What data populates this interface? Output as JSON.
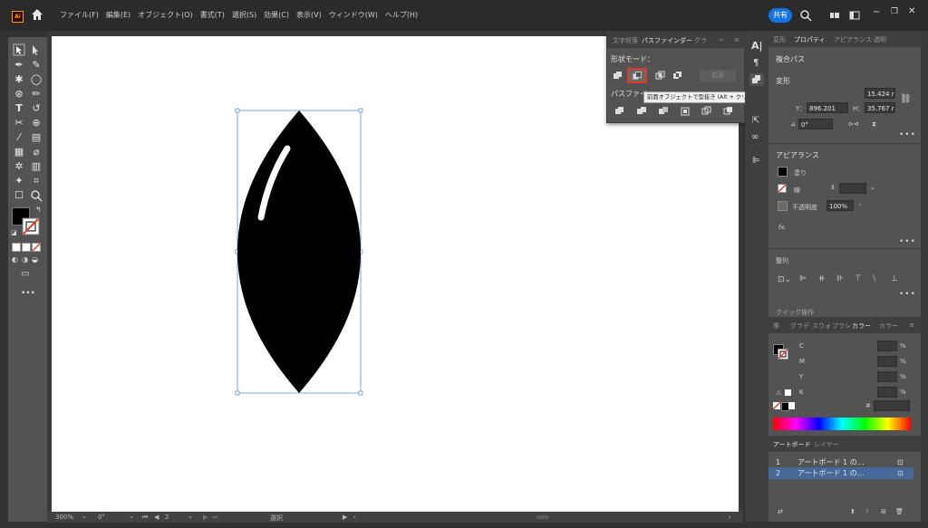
{
  "menubar": {
    "logo": "Ai",
    "items": [
      "ファイル(F)",
      "編集(E)",
      "オブジェクト(O)",
      "書式(T)",
      "選択(S)",
      "効果(C)",
      "表示(V)",
      "ウィンドウ(W)",
      "ヘルプ(H)"
    ],
    "share_label": "共有"
  },
  "pathfinder_panel": {
    "tabs": [
      "文字",
      "段落",
      "パスファインダー",
      "グラ"
    ],
    "active_tab": "パスファインダー",
    "shape_modes_label": "形状モード：",
    "expand_label": "拡張",
    "pathfinders_label": "パスファイ",
    "tooltip": "前面オブジェクトで型抜き (Alt + クリックで複合シェイプを作成して型抜き)"
  },
  "properties_panel": {
    "tabs": [
      "変形",
      "プロパティ",
      "アピアランス",
      "透明"
    ],
    "active_tab": "プロパティ",
    "object_type": "複合パス",
    "transform_label": "変形",
    "y_label": "Y：",
    "y_value": "896.201",
    "h_label": "H：",
    "h_value": "35.767 r",
    "w_value": "15.424 r",
    "angle_value": "0°",
    "appearance_label": "アピアランス",
    "fill_label": "塗り",
    "stroke_label": "線",
    "opacity_label": "不透明度",
    "opacity_value": "100%",
    "fx_label": "fx.",
    "align_label": "整列",
    "quick_actions_label": "クイック操作"
  },
  "color_panel": {
    "tabs": [
      "帯",
      "グラデ",
      "スウォ",
      "ブラシ",
      "カラー",
      "カラー"
    ],
    "active_tab": "カラー",
    "channels": [
      "C",
      "M",
      "Y",
      "K"
    ],
    "percent": "%",
    "hex_label": "#"
  },
  "layers_panel": {
    "tabs": [
      "アートボード",
      "レイヤー"
    ],
    "active_tab": "アートボード",
    "rows": [
      {
        "num": "1",
        "name": "アートボード 1 の…"
      },
      {
        "num": "2",
        "name": "アートボード 1 の…"
      }
    ]
  },
  "statusbar": {
    "zoom": "300%",
    "rotation": "0°",
    "artboard_num": "2",
    "mode": "選択"
  },
  "colors": {
    "accent": "#1473e6",
    "highlight": "#e03a2a",
    "panel_bg": "#535353",
    "ui_bg": "#323232"
  }
}
